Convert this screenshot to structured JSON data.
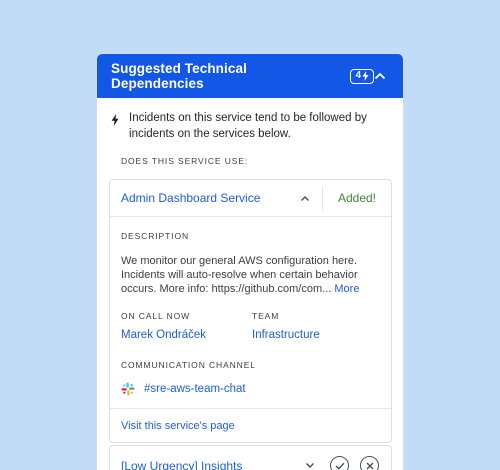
{
  "panel": {
    "title": "Suggested Technical Dependencies",
    "badge_count": "4"
  },
  "intro": {
    "text": "Incidents on this service tend to be followed by incidents on the services below."
  },
  "section_label": "DOES THIS SERVICE USE:",
  "service": {
    "name": "Admin Dashboard Service",
    "status": "Added!",
    "description_label": "DESCRIPTION",
    "description": "We monitor our general AWS configuration here. Incidents will auto-resolve when certain behavior occurs. More info: https://github.com/com...",
    "more_link": "More",
    "on_call_label": "ON CALL NOW",
    "on_call": "Marek Ondráček",
    "team_label": "TEAM",
    "team": "Infrastructure",
    "channel_label": "COMMUNICATION CHANNEL",
    "channel": "#sre-aws-team-chat",
    "visit_link": "Visit this service's page"
  },
  "next_service": {
    "name": "[Low Urgency] Insights"
  },
  "colors": {
    "header": "#1357e6",
    "link": "#1f5fd6",
    "added": "#3c8a3c",
    "background": "#c2dcf8"
  }
}
